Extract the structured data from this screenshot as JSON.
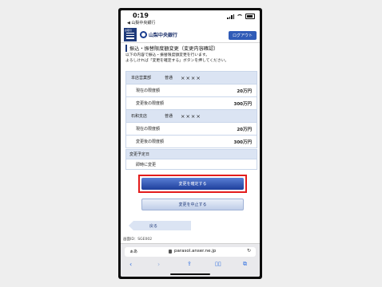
{
  "status": {
    "time": "0:19",
    "back_app": "◀ 山梨中央銀行"
  },
  "appbar": {
    "menu_label": "お取引",
    "bank_name": "山梨中央銀行",
    "logout_label": "ログアウト"
  },
  "page": {
    "title": "振込・振替限度額変更（変更内容確認）",
    "description_1": "以下の内容で振込・振替限度額変更を行います。",
    "description_2": "よろしければ「変更を確定する」ボタンを押してください。"
  },
  "accounts": [
    {
      "branch": "本店営業部",
      "type": "普通",
      "number": "××××",
      "current_label": "現在の限度額",
      "current_value": "20万円",
      "new_label": "変更後の限度額",
      "new_value": "300万円"
    },
    {
      "branch": "石和支店",
      "type": "普通",
      "number": "××××",
      "current_label": "現在の限度額",
      "current_value": "20万円",
      "new_label": "変更後の限度額",
      "new_value": "300万円"
    }
  ],
  "schedule": {
    "label": "変更予定日",
    "value": "即時に変更"
  },
  "buttons": {
    "confirm": "変更を確定する",
    "cancel": "変更を中止する",
    "back": "戻る"
  },
  "screen_id": "画面ID：SGE002",
  "browser": {
    "aa": "ぁあ",
    "url": "parasol.anser.ne.jp"
  },
  "colors": {
    "accent": "#1f3a7a",
    "highlight": "#e31c1c",
    "row_header": "#dbe4f3"
  }
}
